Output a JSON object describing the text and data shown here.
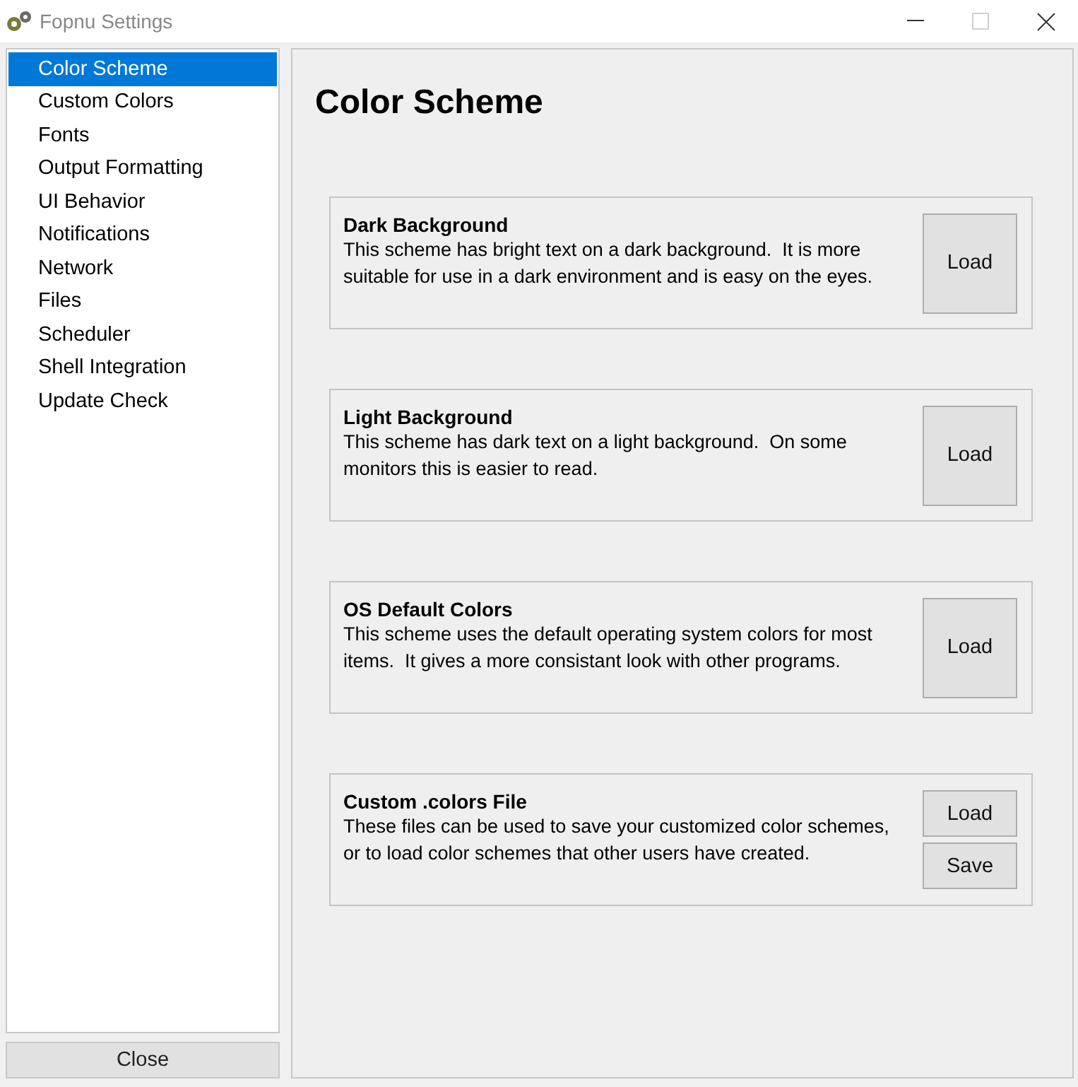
{
  "window": {
    "title": "Fopnu Settings",
    "controls": [
      {
        "kind": "minimize",
        "disabled": false
      },
      {
        "kind": "maximize",
        "disabled": true
      },
      {
        "kind": "close",
        "disabled": false
      }
    ]
  },
  "sidebar": {
    "items": [
      {
        "label": "Color Scheme",
        "selected": true
      },
      {
        "label": "Custom Colors",
        "selected": false
      },
      {
        "label": "Fonts",
        "selected": false
      },
      {
        "label": "Output Formatting",
        "selected": false
      },
      {
        "label": "UI Behavior",
        "selected": false
      },
      {
        "label": "Notifications",
        "selected": false
      },
      {
        "label": "Network",
        "selected": false
      },
      {
        "label": "Files",
        "selected": false
      },
      {
        "label": "Scheduler",
        "selected": false
      },
      {
        "label": "Shell Integration",
        "selected": false
      },
      {
        "label": "Update Check",
        "selected": false
      }
    ],
    "close_button": "Close"
  },
  "panel": {
    "heading": "Color Scheme",
    "schemes": [
      {
        "title": "Dark Background",
        "description": "This scheme has bright text on a dark background.  It is more suitable for use in a dark environment and is easy on the eyes.",
        "buttons": [
          "Load"
        ]
      },
      {
        "title": "Light Background",
        "description": "This scheme has dark text on a light background.  On some monitors this is easier to read.",
        "buttons": [
          "Load"
        ]
      },
      {
        "title": "OS Default Colors",
        "description": "This scheme uses the default operating system colors for most items.  It gives a more consistant look with other programs.",
        "buttons": [
          "Load"
        ]
      },
      {
        "title": "Custom .colors File",
        "description": "These files can be used to save your customized color schemes, or to load color schemes that other users have created.",
        "buttons": [
          "Load",
          "Save"
        ]
      }
    ]
  }
}
